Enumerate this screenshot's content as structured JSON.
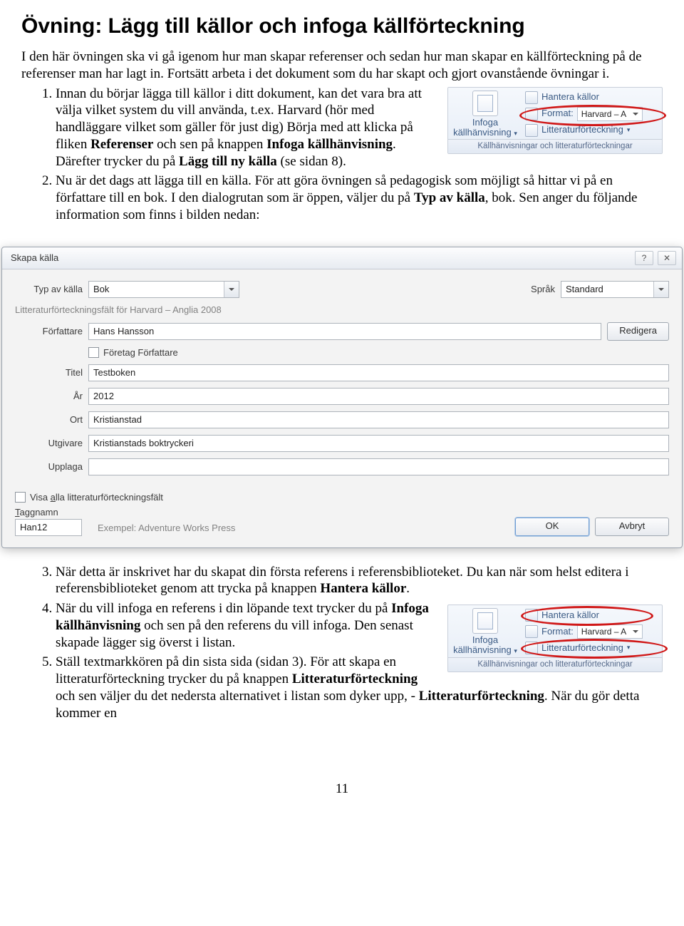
{
  "heading": "Övning: Lägg till källor och infoga källförteckning",
  "intro": "I den här övningen ska vi gå igenom hur man skapar referenser och sedan hur man skapar en källförteckning på de referenser man har lagt in. Fortsätt arbeta i det dokument som du har skapt och gjort ovanstående övningar i.",
  "item1_a": "Innan du börjar lägga till källor i ditt dokument, kan det vara bra att välja vilket system du vill använda, t.ex. Harvard (hör med handläggare vilket som gäller för just dig) Börja med att klicka på fliken ",
  "item1_b1": "Referenser",
  "item1_c": " och sen på knappen ",
  "item1_b2": "Infoga källhänvisning",
  "item1_d": ". Därefter trycker du på ",
  "item1_b3": "Lägg till ny källa",
  "item1_e": " (se sidan 8).",
  "item2_a": "Nu är det dags att lägga till en källa. För att göra övningen så pedagogisk som möjligt så hittar vi på en författare till en bok. I den dialogrutan som är öppen, väljer du på ",
  "item2_b1": "Typ av källa",
  "item2_c": ", bok. Sen anger du följande information som finns i bilden nedan:",
  "item3_a": "När detta är inskrivet har du skapat din första referens i referensbiblioteket. Du kan när som helst editera i referensbiblioteket genom att trycka på knappen ",
  "item3_b1": "Hantera källor",
  "item3_c": ".",
  "item4_a": "När du vill infoga en referens i din löpande text trycker du på ",
  "item4_b1": "Infoga källhänvisning",
  "item4_c": " och sen på den referens du vill infoga. Den senast skapade lägger sig överst i listan.",
  "item5_a": "Ställ textmarkkören på din sista sida (sidan 3). För att skapa en litteraturförteckning trycker du på knappen ",
  "item5_b1": "Litteraturförteckning",
  "item5_c": " och sen väljer du det nedersta alternativet i listan som dyker upp, - ",
  "item5_b2": "Litteraturförteckning",
  "item5_d": ". När du gör detta kommer en",
  "ribbon": {
    "big_label_l1": "Infoga",
    "big_label_l2": "källhänvisning",
    "manage": "Hantera källor",
    "format_lbl": "Format:",
    "format_val": "Harvard – A",
    "bib": "Litteraturförteckning",
    "caption": "Källhänvisningar och litteraturförteckningar"
  },
  "dlg": {
    "title": "Skapa källa",
    "type_label": "Typ av källa",
    "type_val": "Bok",
    "lang_label": "Språk",
    "lang_val": "Standard",
    "subhead": "Litteraturförteckningsfält för Harvard – Anglia 2008",
    "author_label": "Författare",
    "author_val": "Hans Hansson",
    "corp_label": "Företag Författare",
    "title_label": "Titel",
    "title_val": "Testboken",
    "year_label": "År",
    "year_val": "2012",
    "city_label": "Ort",
    "city_val": "Kristianstad",
    "pub_label": "Utgivare",
    "pub_val": "Kristianstads boktryckeri",
    "ed_label": "Upplaga",
    "ed_val": "",
    "showall": "Visa alla litteraturförteckningsfält",
    "tag_label": "Taggnamn",
    "tag_val": "Han12",
    "example": "Exempel: Adventure Works Press",
    "edit": "Redigera",
    "ok": "OK",
    "cancel": "Avbryt"
  },
  "page_number": "11"
}
